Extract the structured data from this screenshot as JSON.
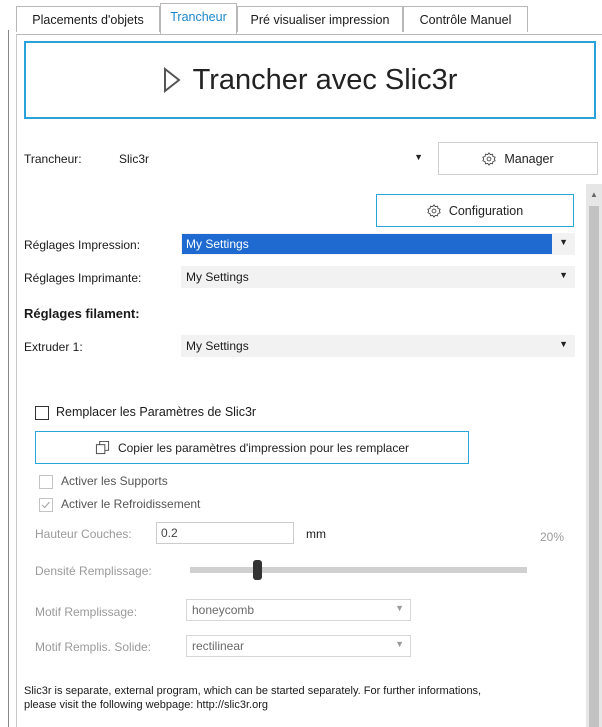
{
  "tabs": [
    "Placements d'objets",
    "Trancheur",
    "Pré visualiser impression",
    "Contrôle Manuel"
  ],
  "slice_button": "Trancher avec Slic3r",
  "slicer": {
    "label": "Trancheur:",
    "value": "Slic3r",
    "manager_label": "Manager"
  },
  "configuration_label": "Configuration",
  "print_settings": {
    "label": "Réglages Impression:",
    "value": "My Settings"
  },
  "printer_settings": {
    "label": "Réglages Imprimante:",
    "value": "My Settings"
  },
  "filament_heading": "Réglages filament:",
  "extruder1": {
    "label": "Extruder 1:",
    "value": "My Settings"
  },
  "override": {
    "label": "Remplacer les Paramètres de Slic3r",
    "checked": false
  },
  "copy_button": "Copier les paramètres d'impression pour les remplacer",
  "supports": {
    "label": "Activer les Supports",
    "checked": false
  },
  "cooling": {
    "label": "Activer le Refroidissement",
    "checked": true
  },
  "layer_height": {
    "label": "Hauteur Couches:",
    "value": "0.2",
    "unit": "mm"
  },
  "infill_percent": "20%",
  "infill_density": {
    "label": "Densité Remplissage:",
    "fraction": 0.2
  },
  "infill_pattern": {
    "label": "Motif Remplissage:",
    "value": "honeycomb"
  },
  "solid_pattern": {
    "label": "Motif Remplis. Solide:",
    "value": "rectilinear"
  },
  "footer_line1": "Slic3r is separate, external program, which can be started separately. For further informations,",
  "footer_line2": "please visit the following webpage: http://slic3r.org",
  "colors": {
    "accent": "#2aa3d8",
    "selection": "#1e6ad1",
    "tab_active": "#1b86c8"
  }
}
